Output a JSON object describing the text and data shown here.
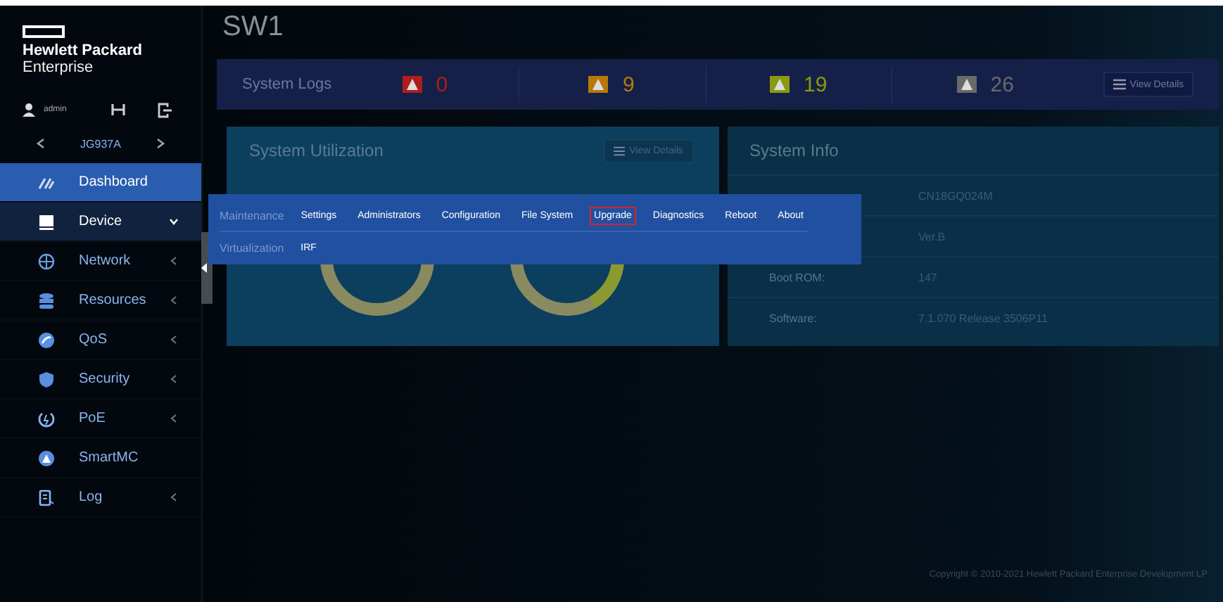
{
  "brand": {
    "line1": "Hewlett Packard",
    "line2": "Enterprise"
  },
  "user": {
    "name": "admin"
  },
  "device": {
    "model": "JG937A"
  },
  "sidebar": {
    "items": [
      {
        "label": "Dashboard",
        "selected": true,
        "expanded": false,
        "submenu": false
      },
      {
        "label": "Device",
        "selected": false,
        "expanded": true,
        "submenu": true
      },
      {
        "label": "Network",
        "selected": false,
        "expanded": false,
        "submenu": true
      },
      {
        "label": "Resources",
        "selected": false,
        "expanded": false,
        "submenu": true
      },
      {
        "label": "QoS",
        "selected": false,
        "expanded": false,
        "submenu": true
      },
      {
        "label": "Security",
        "selected": false,
        "expanded": false,
        "submenu": true
      },
      {
        "label": "PoE",
        "selected": false,
        "expanded": false,
        "submenu": true
      },
      {
        "label": "SmartMC",
        "selected": false,
        "expanded": false,
        "submenu": false
      },
      {
        "label": "Log",
        "selected": false,
        "expanded": false,
        "submenu": true
      }
    ]
  },
  "page": {
    "title": "SW1"
  },
  "logs": {
    "title": "System Logs",
    "counts": [
      {
        "value": "0",
        "color": "#b01c1c"
      },
      {
        "value": "9",
        "color": "#b8780a"
      },
      {
        "value": "19",
        "color": "#8a9a10"
      },
      {
        "value": "26",
        "color": "#6a6a6a"
      }
    ],
    "button": "View Details"
  },
  "utilization": {
    "title": "System Utilization",
    "button": "View Details"
  },
  "info": {
    "title": "System Info",
    "rows": [
      {
        "label": "",
        "value": "CN18GQ024M"
      },
      {
        "label": "",
        "value": "Ver.B"
      },
      {
        "label": "Boot ROM:",
        "value": "147"
      },
      {
        "label": "Software:",
        "value": "7.1.070 Release 3506P11"
      }
    ]
  },
  "menu": {
    "groups": [
      {
        "title": "Maintenance",
        "items": [
          {
            "label": "Settings",
            "selected": false
          },
          {
            "label": "Administrators",
            "selected": false
          },
          {
            "label": "Configuration",
            "selected": false
          },
          {
            "label": "File System",
            "selected": false
          },
          {
            "label": "Upgrade",
            "selected": true
          },
          {
            "label": "Diagnostics",
            "selected": false
          },
          {
            "label": "Reboot",
            "selected": false
          },
          {
            "label": "About",
            "selected": false
          }
        ]
      },
      {
        "title": "Virtualization",
        "items": [
          {
            "label": "IRF",
            "selected": false
          }
        ]
      }
    ]
  },
  "footer": "Copyright © 2010-2021 Hewlett Packard Enterprise Development LP"
}
